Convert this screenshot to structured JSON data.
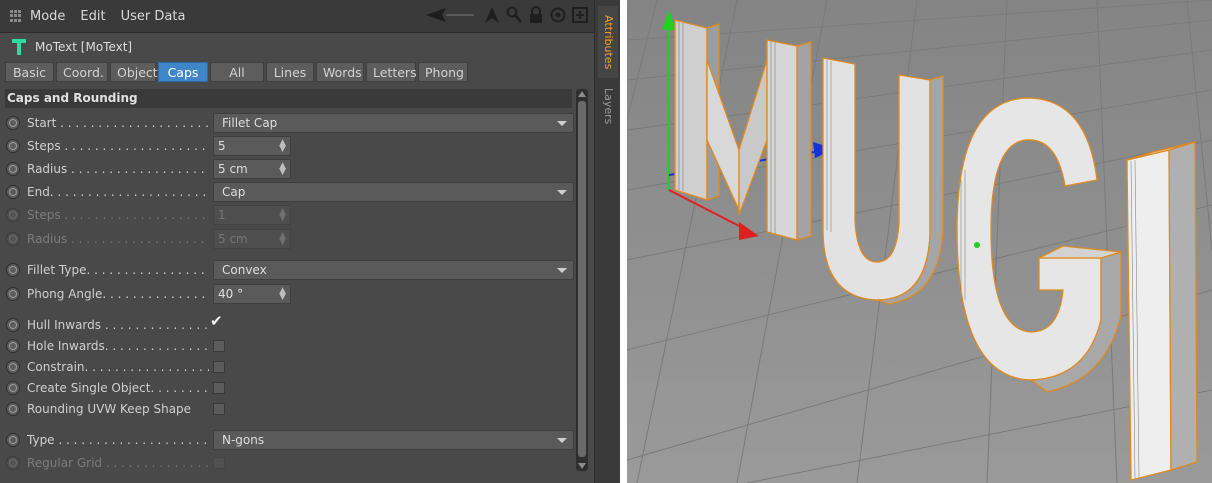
{
  "menubar": {
    "items": [
      "Mode",
      "Edit",
      "User Data"
    ]
  },
  "object": {
    "name": "MoText [MoText]",
    "icon": "motext-icon"
  },
  "tabs": [
    {
      "label": "Basic",
      "active": false
    },
    {
      "label": "Coord.",
      "active": false
    },
    {
      "label": "Object",
      "active": false
    },
    {
      "label": "Caps",
      "active": true
    },
    {
      "label": "All",
      "active": false
    },
    {
      "label": "Lines",
      "active": false
    },
    {
      "label": "Words",
      "active": false
    },
    {
      "label": "Letters",
      "active": false
    },
    {
      "label": "Phong",
      "active": false
    }
  ],
  "section_title": "Caps and Rounding",
  "fields": {
    "start": {
      "label": "Start . . . . . . . . . . . . . . . . . . . .",
      "value": "Fillet Cap"
    },
    "steps1": {
      "label": "Steps . . . . . . . . . . . . . . . . . . . .",
      "value": "5"
    },
    "radius1": {
      "label": "Radius . . . . . . . . . . . . . . . . . . .",
      "value": "5 cm"
    },
    "end": {
      "label": "End. . . . . . . . . . . . . . . . . . . . . .",
      "value": "Cap"
    },
    "steps2": {
      "label": "Steps . . . . . . . . . . . . . . . . . . . .",
      "value": "1"
    },
    "radius2": {
      "label": "Radius . . . . . . . . . . . . . . . . . . .",
      "value": "5 cm"
    },
    "fillet_type": {
      "label": "Fillet Type. . . . . . . . . . . . . . . . .",
      "value": "Convex"
    },
    "phong_angle": {
      "label": "Phong Angle. . . . . . . . . . . . . . .",
      "value": "40 °"
    },
    "hull_inwards": {
      "label": "Hull Inwards . . . . . . . . . . . . . .",
      "checked": true
    },
    "hole_inwards": {
      "label": "Hole Inwards. . . . . . . . . . . . . . .",
      "checked": false
    },
    "constrain": {
      "label": "Constrain. . . . . . . . . . . . . . . . . . .",
      "checked": false
    },
    "create_single": {
      "label": "Create Single Object. . . . . . . .",
      "checked": false
    },
    "rounding_uvw": {
      "label": "Rounding UVW Keep Shape",
      "checked": false
    },
    "type": {
      "label": "Type . . . . . . . . . . . . . . . . . . . . .",
      "value": "N-gons"
    },
    "regular_grid": {
      "label": "Regular Grid . . . . . . . . . . . . . .",
      "checked": false
    }
  },
  "side_tabs": {
    "attributes": "Attributes",
    "layers": "Layers"
  },
  "viewport": {
    "text": "MUGI",
    "selection_color": "#e08a1e"
  }
}
